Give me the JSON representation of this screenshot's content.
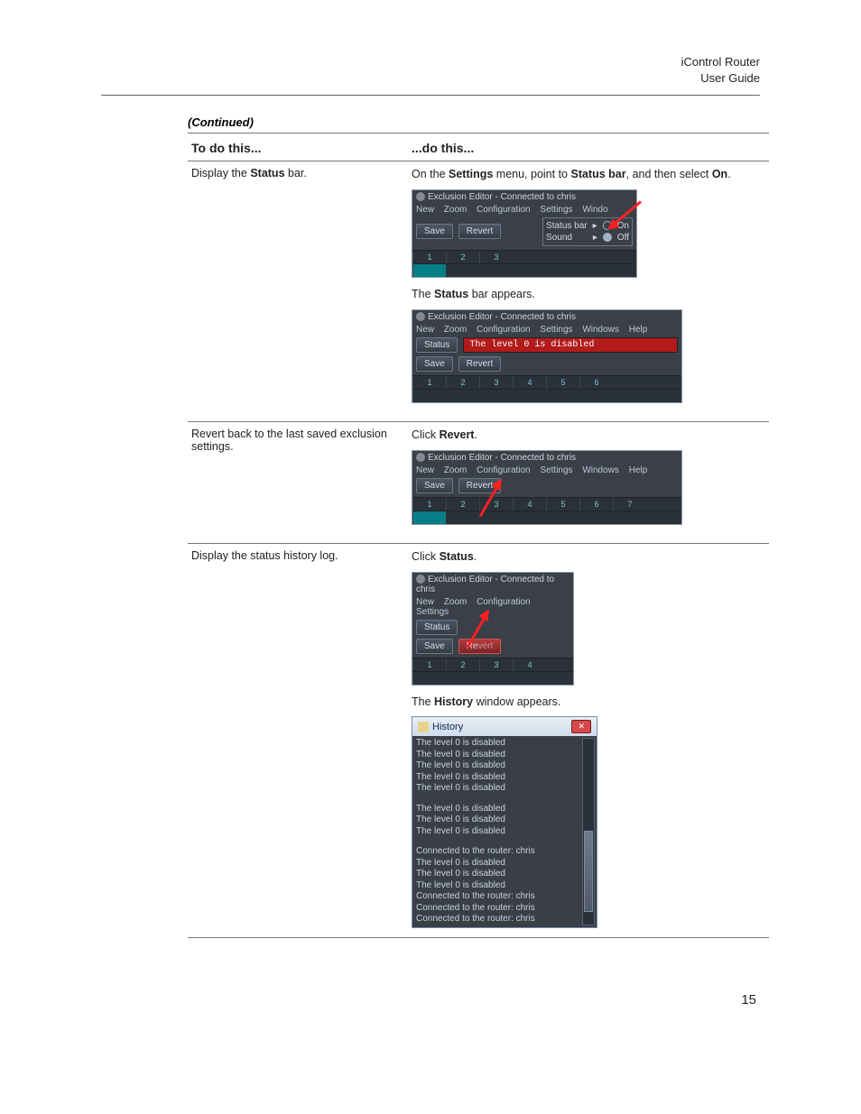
{
  "header": {
    "line1": "iControl Router",
    "line2": "User Guide"
  },
  "continued": "(Continued)",
  "table": {
    "headers": {
      "left": "To do this...",
      "right": "...do this..."
    },
    "rows": [
      {
        "left": "Display the Status bar.",
        "r_sentence_1": {
          "pre": "On the ",
          "b1": "Settings",
          "mid": " menu, point to ",
          "b2": "Status bar",
          "mid2": ", and then select ",
          "b3": "On",
          "post": "."
        },
        "shot1": {
          "title": "Exclusion Editor - Connected to chris",
          "menus": [
            "New",
            "Zoom",
            "Configuration",
            "Settings",
            "Windo"
          ],
          "btn_save": "Save",
          "btn_revert": "Revert",
          "sub_statusbar": "Status bar",
          "sub_sound": "Sound",
          "opt_on": "On",
          "opt_off": "Off"
        },
        "r_sentence_2": {
          "pre": "The ",
          "b1": "Status",
          "post": " bar appears."
        },
        "shot2": {
          "title": "Exclusion Editor - Connected to chris",
          "menus": [
            "New",
            "Zoom",
            "Configuration",
            "Settings",
            "Windows",
            "Help"
          ],
          "btn_status": "Status",
          "status_text": "The level 0 is disabled",
          "btn_save": "Save",
          "btn_revert": "Revert"
        }
      },
      {
        "left": "Revert back to the last saved exclusion settings.",
        "r_sentence": {
          "pre": "Click ",
          "b1": "Revert",
          "post": "."
        },
        "shot": {
          "title": "Exclusion Editor - Connected to chris",
          "menus": [
            "New",
            "Zoom",
            "Configuration",
            "Settings",
            "Windows",
            "Help"
          ],
          "btn_save": "Save",
          "btn_revert": "Revert"
        }
      },
      {
        "left": "Display the status history log.",
        "r_sentence_1": {
          "pre": "Click ",
          "b1": "Status",
          "post": "."
        },
        "shot1": {
          "title": "Exclusion Editor - Connected to chris",
          "menus": [
            "New",
            "Zoom",
            "Configuration",
            "Settings"
          ],
          "btn_status": "Status",
          "btn_save": "Save",
          "btn_revert": "Revert"
        },
        "r_sentence_2": {
          "pre": "The ",
          "b1": "History",
          "post": " window appears."
        },
        "history": {
          "title": "History",
          "lines": [
            "The level 0 is disabled",
            "The level 0 is disabled",
            "The level 0 is disabled",
            "The level 0 is disabled",
            "The level 0 is disabled",
            "",
            "The level 0 is disabled",
            "The level 0 is disabled",
            "The level 0 is disabled",
            "",
            "Connected to the router: chris",
            "The level 0 is disabled",
            "The level 0 is disabled",
            "The level 0 is disabled",
            "Connected to the router: chris",
            "Connected to the router: chris",
            "Connected to the router: chris"
          ]
        }
      }
    ]
  },
  "page_number": "15"
}
